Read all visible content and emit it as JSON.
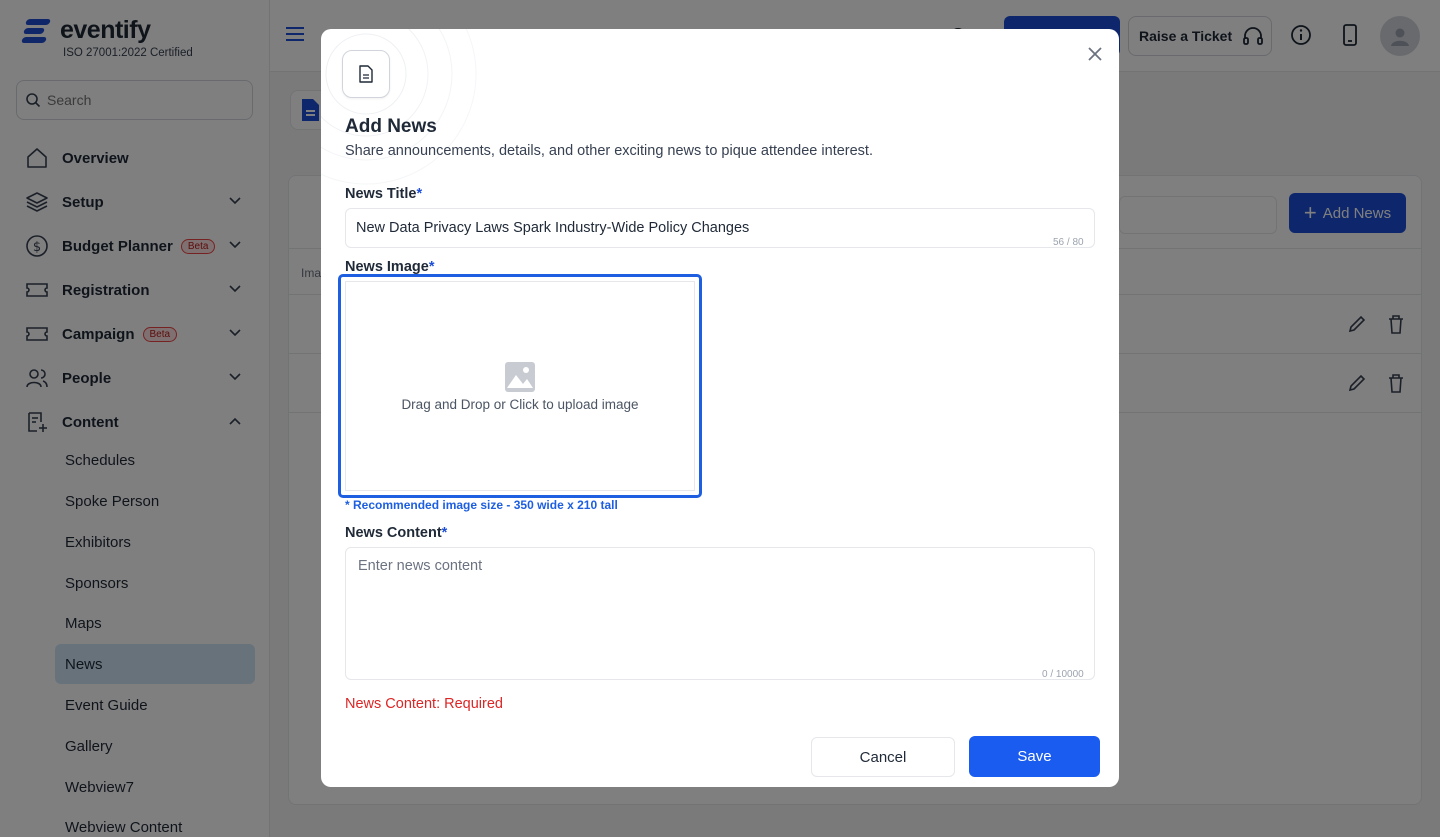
{
  "brand": {
    "name": "eventify",
    "certification": "ISO 27001:2022 Certified"
  },
  "sidebar": {
    "search_placeholder": "Search",
    "items": [
      {
        "label": "Overview"
      },
      {
        "label": "Setup"
      },
      {
        "label": "Budget Planner",
        "badge": "Beta"
      },
      {
        "label": "Registration"
      },
      {
        "label": "Campaign",
        "badge": "Beta"
      },
      {
        "label": "People"
      },
      {
        "label": "Content"
      }
    ],
    "content_subitems": [
      "Schedules",
      "Spoke Person",
      "Exhibitors",
      "Sponsors",
      "Maps",
      "News",
      "Event Guide",
      "Gallery",
      "Webview7",
      "Webview Content"
    ],
    "active_subitem": "News"
  },
  "header": {
    "ticket_label": "Raise a Ticket"
  },
  "page": {
    "add_button_label": "Add News",
    "column_header": "Ima"
  },
  "modal": {
    "title": "Add News",
    "subtitle": "Share announcements, details, and other exciting news to pique attendee interest.",
    "title_field": {
      "label": "News Title",
      "required_mark": "*",
      "value": "New Data Privacy Laws Spark Industry-Wide Policy Changes",
      "counter": "56 / 80"
    },
    "image_field": {
      "label": "News Image",
      "required_mark": "*",
      "upload_text": "Drag and Drop or Click to upload image",
      "hint": "* Recommended image size - 350 wide x 210 tall"
    },
    "content_field": {
      "label": "News Content",
      "required_mark": "*",
      "placeholder": "Enter news content",
      "counter": "0 / 10000",
      "error": "News Content: Required"
    },
    "cancel_label": "Cancel",
    "save_label": "Save"
  },
  "colors": {
    "primary": "#1d4ed8",
    "save": "#1a5cf0",
    "error": "#dc2626",
    "active_nav": "#cfe5f6"
  }
}
